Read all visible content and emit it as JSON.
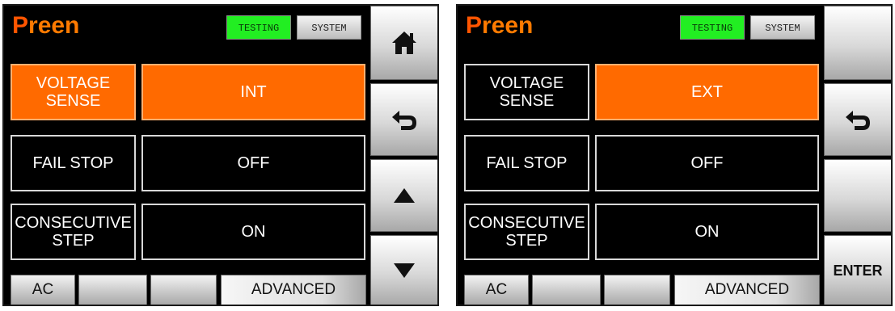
{
  "screens": [
    {
      "logo": {
        "first": "P",
        "rest": "reen"
      },
      "tabs": {
        "testing": "TESTING",
        "system": "SYSTEM"
      },
      "rows": [
        {
          "label": "VOLTAGE\nSENSE",
          "value": "INT"
        },
        {
          "label": "FAIL STOP",
          "value": "OFF"
        },
        {
          "label": "CONSECUTIVE\nSTEP",
          "value": "ON"
        }
      ],
      "side": {
        "home_icon": "home-icon",
        "back_icon": "return-arrow-icon",
        "up_icon": "up-triangle-icon",
        "down_icon": "down-triangle-icon"
      },
      "bottom": {
        "b1": "AC",
        "b2": "",
        "b3": "",
        "b4": "ADVANCED"
      }
    },
    {
      "logo": {
        "first": "P",
        "rest": "reen"
      },
      "tabs": {
        "testing": "TESTING",
        "system": "SYSTEM"
      },
      "rows": [
        {
          "label": "VOLTAGE\nSENSE",
          "value": "EXT"
        },
        {
          "label": "FAIL STOP",
          "value": "OFF"
        },
        {
          "label": "CONSECUTIVE\nSTEP",
          "value": "ON"
        }
      ],
      "side": {
        "back_icon": "return-arrow-icon",
        "enter": "ENTER"
      },
      "bottom": {
        "b1": "AC",
        "b2": "",
        "b3": "",
        "b4": "ADVANCED"
      }
    }
  ],
  "colors": {
    "highlight": "#ff6a00",
    "testing_tab": "#22ee22",
    "logo": "#ff7a00"
  }
}
